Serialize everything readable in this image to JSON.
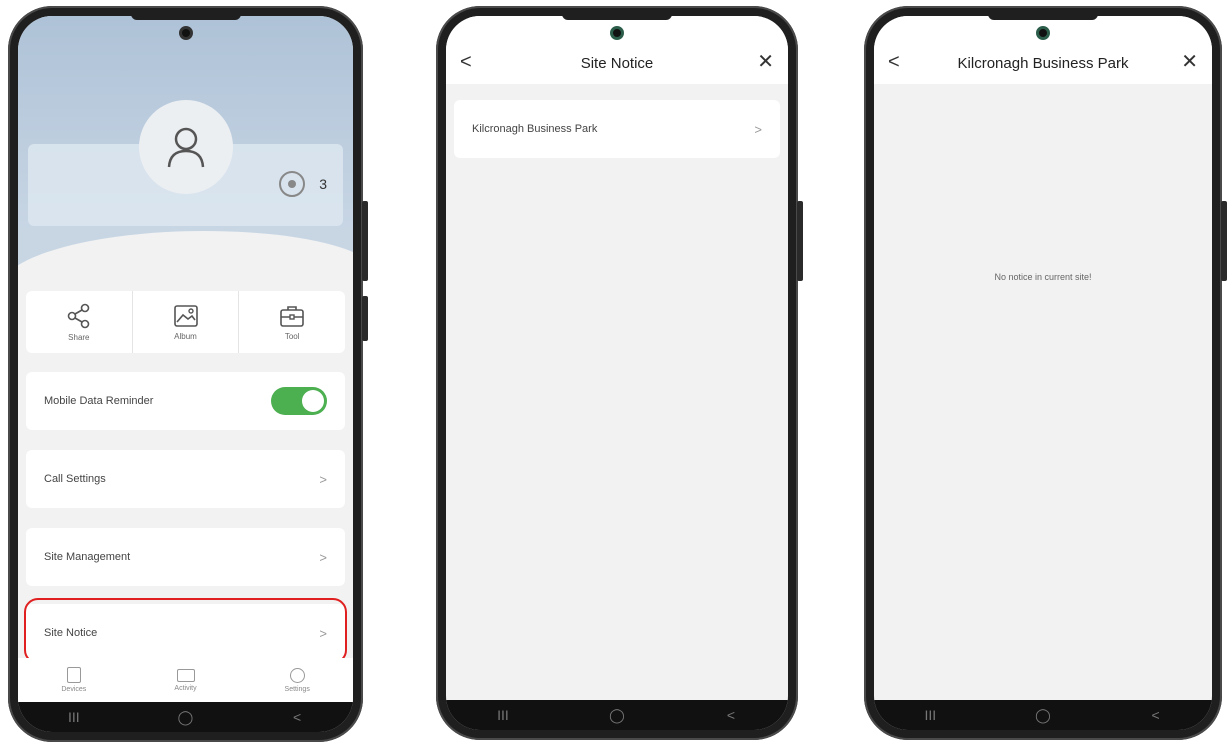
{
  "phone1": {
    "device_count": "3",
    "quick_actions": [
      {
        "label": "Share",
        "icon": "share-icon"
      },
      {
        "label": "Album",
        "icon": "album-icon"
      },
      {
        "label": "Tool",
        "icon": "toolbox-icon"
      }
    ],
    "mobile_data_reminder_label": "Mobile Data Reminder",
    "mobile_data_reminder_on": true,
    "call_settings_label": "Call Settings",
    "site_management_label": "Site Management",
    "site_notice_label": "Site Notice",
    "tabs": [
      {
        "label": "Devices",
        "icon": "devices-icon"
      },
      {
        "label": "Activity",
        "icon": "activity-icon"
      },
      {
        "label": "Settings",
        "icon": "settings-icon"
      }
    ],
    "chevron": ">",
    "highlight_color": "#e02020",
    "toggle_color": "#4caf50"
  },
  "phone2": {
    "title": "Site Notice",
    "back": "<",
    "close": "✕",
    "items": [
      {
        "label": "Kilcronagh Business Park"
      }
    ],
    "chevron": ">"
  },
  "phone3": {
    "title": "Kilcronagh Business Park",
    "back": "<",
    "close": "✕",
    "empty_message": "No notice in current site!"
  },
  "system_nav": {
    "recents": "III",
    "home": "◯",
    "back": "<"
  }
}
